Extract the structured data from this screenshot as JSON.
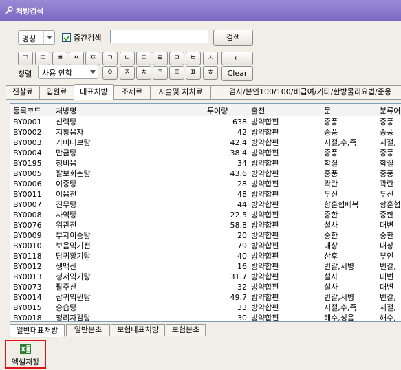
{
  "window": {
    "title": "처방검색"
  },
  "search": {
    "field_select": "명칭",
    "middle_search_label": "중간검색",
    "middle_search_checked": true,
    "query_value": "",
    "search_button": "검색"
  },
  "jamo_row1": [
    "ㄲ",
    "ㄸ",
    "ㅃ",
    "ㅆ",
    "ㅉ",
    "ㄱ",
    "ㄴ",
    "ㄷ",
    "ㄹ",
    "ㅁ",
    "ㅂ",
    "ㅅ"
  ],
  "jamo_row2": [
    "ㅇ",
    "ㅈ",
    "ㅊ",
    "ㅋ",
    "ㅌ",
    "ㅍ",
    "ㅎ"
  ],
  "backspace_button": "←",
  "clear_button": "Clear",
  "sort": {
    "label": "정렬",
    "value": "사용 안함"
  },
  "top_tabs": [
    "진찰료",
    "입원료",
    "대표처방",
    "조제료",
    "시술및 처치료",
    "검사/본인100/100/비급여/기타/한방물리요법/준용"
  ],
  "active_top_tab": 2,
  "table": {
    "headers": [
      "등록코드",
      "처방명",
      "투여량",
      "출전",
      "문",
      "분류어"
    ],
    "rows": [
      [
        "BY0001",
        "신력탕",
        "638",
        "방약합편",
        "중풍",
        "중풍"
      ],
      [
        "BY0002",
        "지황음자",
        "42",
        "방약합편",
        "중풍",
        "중풍"
      ],
      [
        "BY0003",
        "가미대보탕",
        "42.4",
        "방약합편",
        "지절,수,족",
        "지절,"
      ],
      [
        "BY0004",
        "만금탕",
        "38.4",
        "방약합편",
        "중풍",
        "중풍"
      ],
      [
        "BY0195",
        "청비음",
        "34",
        "방약합편",
        "학질",
        "학질"
      ],
      [
        "BY0005",
        "팔보회춘탕",
        "43.6",
        "방약합편",
        "중풍",
        "중풍"
      ],
      [
        "BY0006",
        "이중탕",
        "28",
        "방약합편",
        "곽란",
        "곽란"
      ],
      [
        "BY0011",
        "이음전",
        "48",
        "방약합편",
        "두신",
        "두신"
      ],
      [
        "BY0007",
        "진무탕",
        "44",
        "방약합편",
        "향훈협배복",
        "향훈협"
      ],
      [
        "BY0008",
        "사역탕",
        "22.5",
        "방약합편",
        "중한",
        "중한"
      ],
      [
        "BY0076",
        "위관전",
        "58.8",
        "방약합편",
        "설사",
        "대변"
      ],
      [
        "BY0009",
        "부자이중탕",
        "20",
        "방약합편",
        "중한",
        "중한"
      ],
      [
        "BY0010",
        "보음익기전",
        "79",
        "방약합편",
        "내상",
        "내상"
      ],
      [
        "BY0118",
        "당귀황기탕",
        "40",
        "방약합편",
        "산후",
        "부인"
      ],
      [
        "BY0012",
        "생맥산",
        "16",
        "방약합편",
        "번갈,서병",
        "번갈,"
      ],
      [
        "BY0013",
        "청서익기탕",
        "31.7",
        "방약합편",
        "설사",
        "대변"
      ],
      [
        "BY0073",
        "팔주산",
        "32",
        "방약합편",
        "설사",
        "대변"
      ],
      [
        "BY0014",
        "삼귀익원탕",
        "49.7",
        "방약합편",
        "번갈,서병",
        "번갈,"
      ],
      [
        "BY0015",
        "승습탕",
        "33",
        "방약합편",
        "지절,수,족",
        "지절,"
      ],
      [
        "BY0018",
        "청리자감탕",
        "30",
        "방약합편",
        "해수,성음",
        "해수,"
      ]
    ]
  },
  "bottom_tabs": [
    "일반대표처방",
    "일반본초",
    "보험대표처방",
    "보험본초"
  ],
  "active_bottom_tab": 0,
  "excel_button": {
    "label": "엑셀저장",
    "icon": "excel-icon"
  }
}
